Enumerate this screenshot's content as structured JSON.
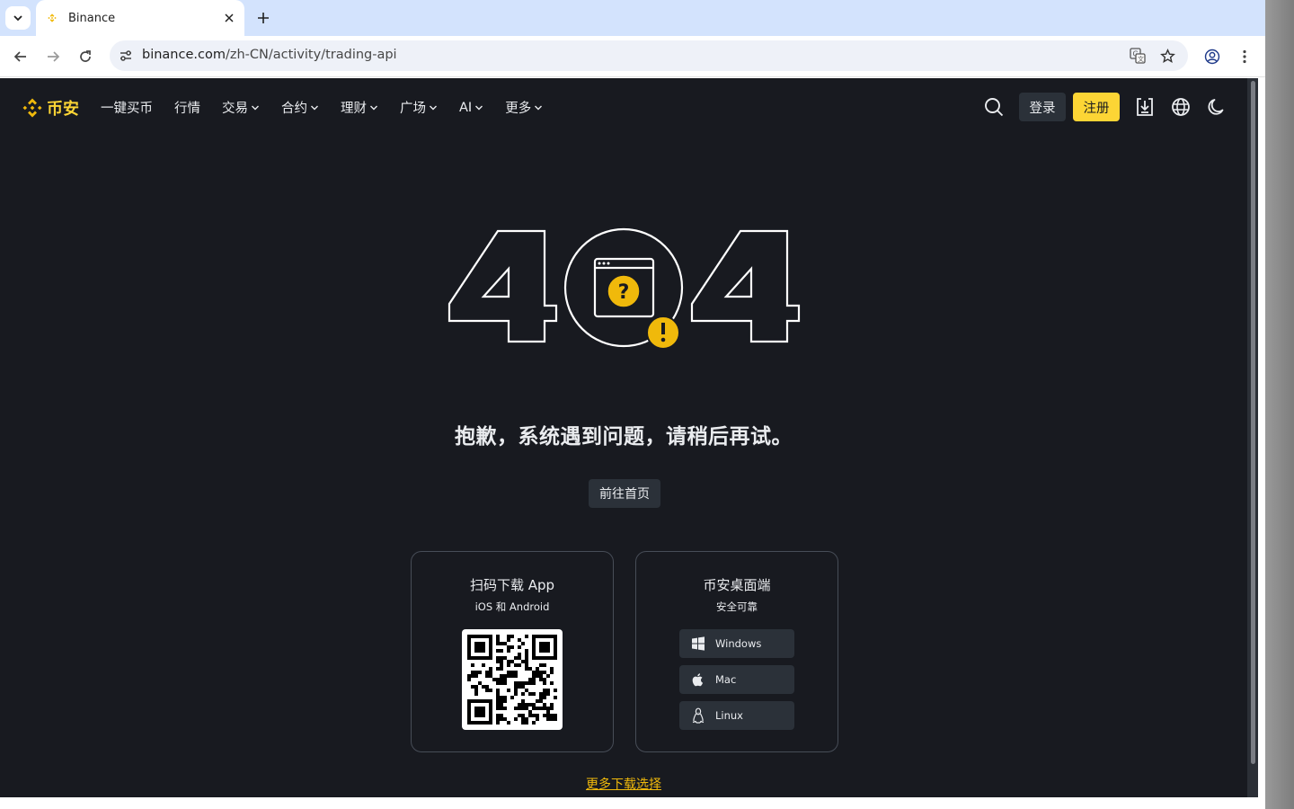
{
  "browser": {
    "tab": {
      "title": "Binance"
    },
    "url_host": "binance.com",
    "url_path": "/zh-CN/activity/trading-api",
    "icons": {
      "tab_search": "chevron-down-icon",
      "close": "close-icon",
      "new_tab": "plus-icon",
      "back": "back-arrow-icon",
      "forward": "forward-arrow-icon",
      "reload": "reload-icon",
      "site_info": "tune-icon",
      "translate": "translate-icon",
      "bookmark": "star-icon",
      "profile": "profile-icon",
      "menu": "kebab-menu-icon"
    }
  },
  "header": {
    "logo_text": "币安",
    "nav": [
      {
        "label": "一键买币",
        "dropdown": false
      },
      {
        "label": "行情",
        "dropdown": false
      },
      {
        "label": "交易",
        "dropdown": true
      },
      {
        "label": "合约",
        "dropdown": true
      },
      {
        "label": "理财",
        "dropdown": true
      },
      {
        "label": "广场",
        "dropdown": true
      },
      {
        "label": "AI",
        "dropdown": true
      },
      {
        "label": "更多",
        "dropdown": true
      }
    ],
    "login": "登录",
    "register": "注册"
  },
  "main": {
    "error_message": "抱歉，系统遇到问题，请稍后再试。",
    "home_button": "前往首页",
    "app_card": {
      "title": "扫码下载 App",
      "subtitle": "iOS 和 Android"
    },
    "desktop_card": {
      "title": "币安桌面端",
      "subtitle": "安全可靠",
      "buttons": [
        "Windows",
        "Mac",
        "Linux"
      ]
    },
    "more_downloads": "更多下载选择"
  },
  "colors": {
    "brand": "#fcd535",
    "background": "#181a20",
    "surface": "#2b3139",
    "text": "#eaecef",
    "link": "#f0b90b"
  }
}
